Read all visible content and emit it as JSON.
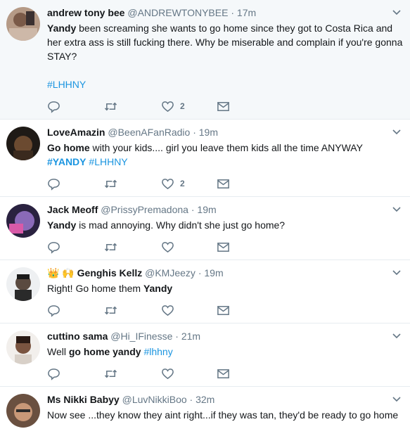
{
  "tweets": [
    {
      "fullname": "andrew tony bee",
      "username": "@ANDREWTONYBEE",
      "time": "17m",
      "text": [
        {
          "t": "Yandy",
          "style": "bold"
        },
        {
          "t": " been screaming she wants to go home since they got to Costa Rica and her extra ass is still fucking there. Why be miserable and complain if you're gonna STAY?"
        },
        {
          "t": "\n\n"
        },
        {
          "t": "#LHHNY",
          "style": "hashtag"
        }
      ],
      "likes": "2",
      "highlight": true
    },
    {
      "fullname": "LoveAmazin",
      "username": "@BeenAFanRadio",
      "time": "19m",
      "text": [
        {
          "t": "Go home",
          "style": "bold"
        },
        {
          "t": " with your kids.... girl you leave them kids all the time ANYWAY "
        },
        {
          "t": "#YANDY",
          "style": "hashtag-bold"
        },
        {
          "t": " "
        },
        {
          "t": "#LHHNY",
          "style": "hashtag"
        }
      ],
      "likes": "2",
      "highlight": false
    },
    {
      "fullname": "Jack Meoff",
      "username": "@PrissyPremadona",
      "time": "19m",
      "text": [
        {
          "t": "Yandy",
          "style": "bold"
        },
        {
          "t": " is mad annoying. Why didn't she just go home?"
        }
      ],
      "likes": "",
      "highlight": false
    },
    {
      "fullname": "Genghis Kellz",
      "username": "@KMJeezy",
      "time": "19m",
      "name_emoji": "👑 🙌",
      "text": [
        {
          "t": "Right! Go home them "
        },
        {
          "t": "Yandy",
          "style": "bold"
        }
      ],
      "likes": "",
      "highlight": false
    },
    {
      "fullname": "cuttino sama",
      "username": "@Hi_IFinesse",
      "time": "21m",
      "text": [
        {
          "t": "Well "
        },
        {
          "t": "go home yandy",
          "style": "bold"
        },
        {
          "t": " "
        },
        {
          "t": "#lhhny",
          "style": "hashtag"
        }
      ],
      "likes": "",
      "highlight": false
    },
    {
      "fullname": "Ms Nikki Babyy",
      "username": "@LuvNikkiBoo",
      "time": "32m",
      "text": [
        {
          "t": "Now see ...they know they aint right...if they was tan, they'd be ready to go home"
        }
      ],
      "likes": "",
      "highlight": false
    }
  ],
  "separator": "·",
  "icons": {
    "reply": "reply-icon",
    "retweet": "retweet-icon",
    "like": "heart-icon",
    "dm": "envelope-icon",
    "caret": "chevron-down-icon"
  },
  "colors": {
    "link": "#1b95e0",
    "secondary": "#657786",
    "highlight_bg": "#f5f8fa",
    "border": "#e6ecf0"
  }
}
